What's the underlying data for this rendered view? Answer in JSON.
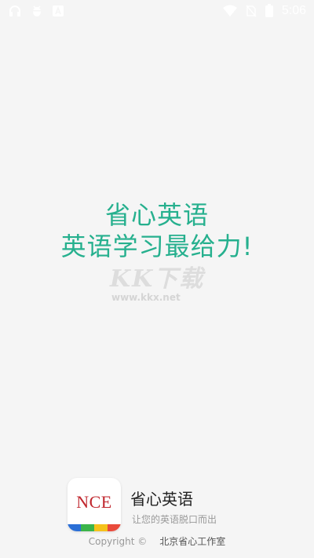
{
  "status_bar": {
    "time": "5:06",
    "left_icons": [
      "headset-icon",
      "bug-icon",
      "font-icon"
    ],
    "right_icons": [
      "wifi-icon",
      "no-sim-icon",
      "battery-icon"
    ]
  },
  "slogan": {
    "line1": "省心英语",
    "line2": "英语学习最给力!"
  },
  "watermark": {
    "logo": "KK下载",
    "url": "www.kkx.net"
  },
  "footer": {
    "icon_text": "NCE",
    "app_name": "省心英语",
    "tagline": "让您的英语脱口而出",
    "copyright": "Copyright ©",
    "studio": "北京省心工作室"
  },
  "colors": {
    "background": "#f5f5f5",
    "accent": "#26b08e",
    "icon_text": "#c0262d",
    "icon_bar": [
      "#2b6fd6",
      "#3bb44a",
      "#f5c21b",
      "#e94b3c"
    ]
  }
}
